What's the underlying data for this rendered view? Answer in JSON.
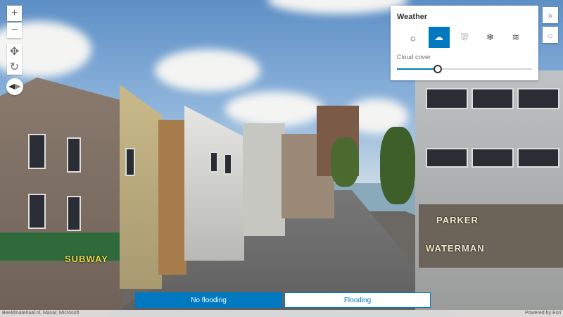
{
  "navigation": {
    "zoom_in": "+",
    "zoom_out": "−"
  },
  "weather": {
    "title": "Weather",
    "options": [
      {
        "name": "sunny",
        "icon": "☼"
      },
      {
        "name": "cloudy",
        "icon": "☁",
        "selected": true
      },
      {
        "name": "rainy",
        "icon": "⛆"
      },
      {
        "name": "snowy",
        "icon": "❄"
      },
      {
        "name": "foggy",
        "icon": "≋"
      }
    ],
    "cloud_cover_label": "Cloud cover",
    "cloud_cover_value": 0.3,
    "collapse_icon": "»",
    "weather_toggle_icon": "☼"
  },
  "flood_toggle": {
    "no_flooding": "No flooding",
    "flooding": "Flooding",
    "selected": "no_flooding"
  },
  "attribution": {
    "left": "Beeldmateriaal.nl, Maxar, Microsoft",
    "right": "Powered by Esri"
  },
  "scene_signs": {
    "subway": "SUBWAY",
    "parker": "PARKER",
    "waterman": "WATERMAN"
  },
  "colors": {
    "accent": "#0079c1"
  }
}
